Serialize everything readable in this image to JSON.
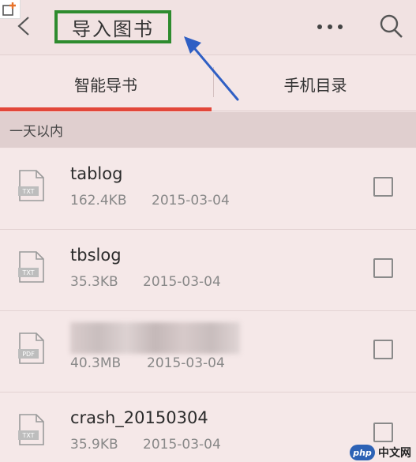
{
  "header": {
    "title": "导入图书"
  },
  "tabs": [
    {
      "label": "智能导书",
      "active": true
    },
    {
      "label": "手机目录",
      "active": false
    }
  ],
  "section": {
    "label": "一天以内"
  },
  "files": [
    {
      "icon_label": "TXT",
      "name": "tablog",
      "size": "162.4KB",
      "date": "2015-03-04"
    },
    {
      "icon_label": "TXT",
      "name": "tbslog",
      "size": "35.3KB",
      "date": "2015-03-04"
    },
    {
      "icon_label": "PDF",
      "name": "",
      "size": "40.3MB",
      "date": "2015-03-04"
    },
    {
      "icon_label": "TXT",
      "name": "crash_20150304",
      "size": "35.9KB",
      "date": "2015-03-04"
    }
  ],
  "watermark": {
    "logo": "php",
    "text": "中文网"
  },
  "colors": {
    "accent": "#e2473a",
    "title_box": "#2e8b2e",
    "arrow": "#2f5fc4"
  },
  "icons": [
    "back-arrow-icon",
    "more-icon",
    "search-icon",
    "file-icon",
    "add-icon"
  ]
}
